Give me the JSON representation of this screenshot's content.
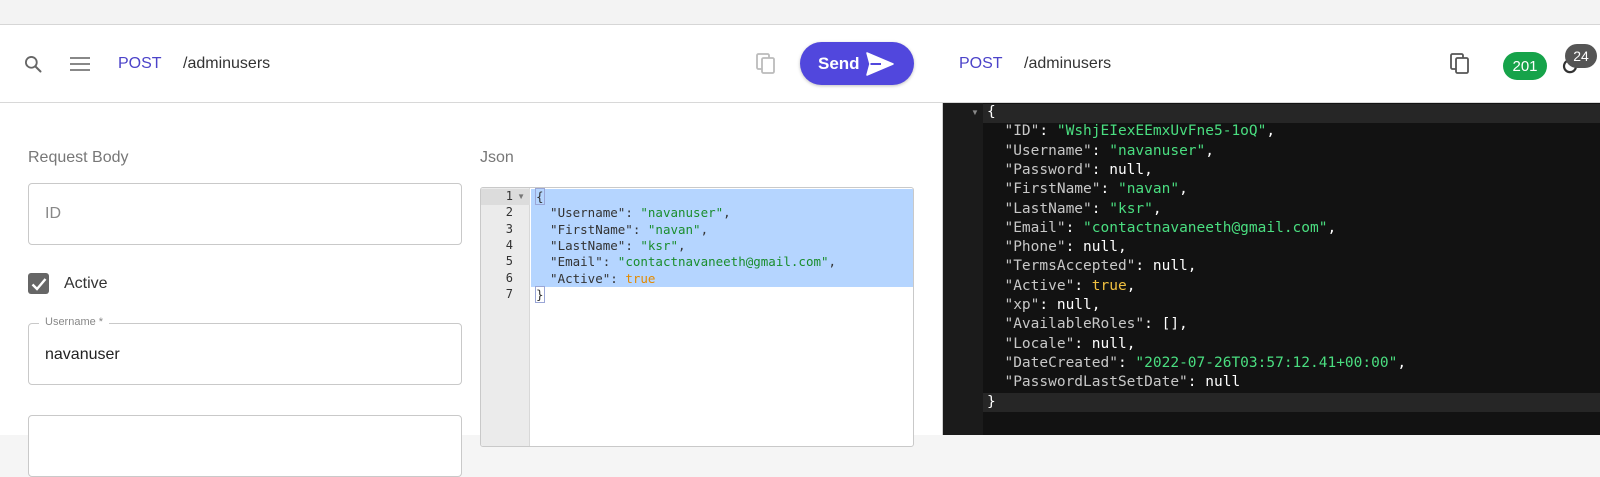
{
  "request": {
    "method": "POST",
    "path": "/adminusers",
    "send_label": "Send",
    "section_label": "Request Body",
    "json_label": "Json",
    "id_placeholder": "ID",
    "active_label": "Active",
    "active_checked": true,
    "username_label": "Username *",
    "username_value": "navanuser",
    "editor_lines": [
      {
        "n": "1",
        "tokens": [
          {
            "t": "{",
            "c": "p"
          }
        ]
      },
      {
        "n": "2",
        "tokens": [
          {
            "t": "  \"Username\"",
            "c": "k"
          },
          {
            "t": ": ",
            "c": "p"
          },
          {
            "t": "\"navanuser\"",
            "c": "s"
          },
          {
            "t": ",",
            "c": "p"
          }
        ]
      },
      {
        "n": "3",
        "tokens": [
          {
            "t": "  \"FirstName\"",
            "c": "k"
          },
          {
            "t": ": ",
            "c": "p"
          },
          {
            "t": "\"navan\"",
            "c": "s"
          },
          {
            "t": ",",
            "c": "p"
          }
        ]
      },
      {
        "n": "4",
        "tokens": [
          {
            "t": "  \"LastName\"",
            "c": "k"
          },
          {
            "t": ": ",
            "c": "p"
          },
          {
            "t": "\"ksr\"",
            "c": "s"
          },
          {
            "t": ",",
            "c": "p"
          }
        ]
      },
      {
        "n": "5",
        "tokens": [
          {
            "t": "  \"Email\"",
            "c": "k"
          },
          {
            "t": ": ",
            "c": "p"
          },
          {
            "t": "\"contactnavaneeth@gmail.com\"",
            "c": "s"
          },
          {
            "t": ",",
            "c": "p"
          }
        ]
      },
      {
        "n": "6",
        "tokens": [
          {
            "t": "  \"Active\"",
            "c": "k"
          },
          {
            "t": ": ",
            "c": "p"
          },
          {
            "t": "true",
            "c": "b"
          }
        ]
      },
      {
        "n": "7",
        "tokens": [
          {
            "t": "}",
            "c": "p"
          }
        ]
      }
    ]
  },
  "response": {
    "method": "POST",
    "path": "/adminusers",
    "status_code": "201",
    "count_badge": "24",
    "lines": [
      [
        {
          "t": "{",
          "c": "dn"
        }
      ],
      [
        {
          "t": "  \"ID\"",
          "c": "dk"
        },
        {
          "t": ": ",
          "c": "dn"
        },
        {
          "t": "\"WshjEIexEEmxUvFne5-1oQ\"",
          "c": "ds"
        },
        {
          "t": ",",
          "c": "dn"
        }
      ],
      [
        {
          "t": "  \"Username\"",
          "c": "dk"
        },
        {
          "t": ": ",
          "c": "dn"
        },
        {
          "t": "\"navanuser\"",
          "c": "ds"
        },
        {
          "t": ",",
          "c": "dn"
        }
      ],
      [
        {
          "t": "  \"Password\"",
          "c": "dk"
        },
        {
          "t": ": null,",
          "c": "dn"
        }
      ],
      [
        {
          "t": "  \"FirstName\"",
          "c": "dk"
        },
        {
          "t": ": ",
          "c": "dn"
        },
        {
          "t": "\"navan\"",
          "c": "ds"
        },
        {
          "t": ",",
          "c": "dn"
        }
      ],
      [
        {
          "t": "  \"LastName\"",
          "c": "dk"
        },
        {
          "t": ": ",
          "c": "dn"
        },
        {
          "t": "\"ksr\"",
          "c": "ds"
        },
        {
          "t": ",",
          "c": "dn"
        }
      ],
      [
        {
          "t": "  \"Email\"",
          "c": "dk"
        },
        {
          "t": ": ",
          "c": "dn"
        },
        {
          "t": "\"contactnavaneeth@gmail.com\"",
          "c": "ds"
        },
        {
          "t": ",",
          "c": "dn"
        }
      ],
      [
        {
          "t": "  \"Phone\"",
          "c": "dk"
        },
        {
          "t": ": null,",
          "c": "dn"
        }
      ],
      [
        {
          "t": "  \"TermsAccepted\"",
          "c": "dk"
        },
        {
          "t": ": null,",
          "c": "dn"
        }
      ],
      [
        {
          "t": "  \"Active\"",
          "c": "dk"
        },
        {
          "t": ": ",
          "c": "dn"
        },
        {
          "t": "true",
          "c": "db"
        },
        {
          "t": ",",
          "c": "dn"
        }
      ],
      [
        {
          "t": "  \"xp\"",
          "c": "dk"
        },
        {
          "t": ": null,",
          "c": "dn"
        }
      ],
      [
        {
          "t": "  \"AvailableRoles\"",
          "c": "dk"
        },
        {
          "t": ": [],",
          "c": "dn"
        }
      ],
      [
        {
          "t": "  \"Locale\"",
          "c": "dk"
        },
        {
          "t": ": null,",
          "c": "dn"
        }
      ],
      [
        {
          "t": "  \"DateCreated\"",
          "c": "dk"
        },
        {
          "t": ": ",
          "c": "dn"
        },
        {
          "t": "\"2022-07-26T03:57:12.41+00:00\"",
          "c": "ds"
        },
        {
          "t": ",",
          "c": "dn"
        }
      ],
      [
        {
          "t": "  \"PasswordLastSetDate\"",
          "c": "dk"
        },
        {
          "t": ": null",
          "c": "dn"
        }
      ],
      [
        {
          "t": "}",
          "c": "dn"
        }
      ]
    ]
  },
  "icons": {
    "search": "search-icon",
    "menu": "menu-icon",
    "copy": "copy-icon",
    "send": "send-icon",
    "refresh": "refresh-icon"
  },
  "colors": {
    "accent": "#5147dd",
    "status_success": "#16a34a",
    "json_string": "#1a8d2d",
    "json_bool": "#e38a00",
    "dark_bg": "#121212"
  }
}
